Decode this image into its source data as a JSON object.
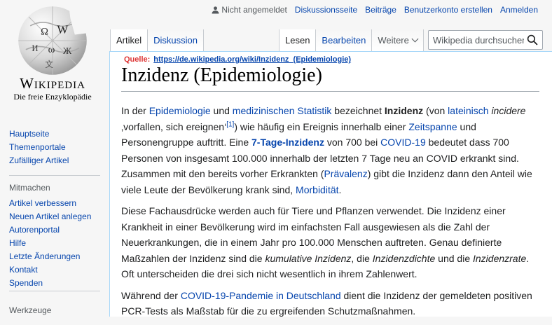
{
  "personal": {
    "user_status": "Nicht angemeldet",
    "links": [
      "Diskussionsseite",
      "Beiträge",
      "Benutzerkonto erstellen",
      "Anmelden"
    ]
  },
  "logo": {
    "wordmark": "Wikipedia",
    "tagline": "Die freie Enzyklopädie"
  },
  "sidebar": {
    "nav": [
      "Hauptseite",
      "Themenportale",
      "Zufälliger Artikel"
    ],
    "mitmachen_heading": "Mitmachen",
    "mitmachen": [
      "Artikel verbessern",
      "Neuen Artikel anlegen",
      "Autorenportal",
      "Hilfe",
      "Letzte Änderungen",
      "Kontakt",
      "Spenden"
    ],
    "werkzeuge_heading": "Werkzeuge"
  },
  "tabs": {
    "left": [
      "Artikel",
      "Diskussion"
    ],
    "right": [
      "Lesen",
      "Bearbeiten",
      "Weitere"
    ]
  },
  "search": {
    "placeholder": "Wikipedia durchsuchen"
  },
  "article": {
    "source_label": "Quelle:",
    "source_url": "https://de.wikipedia.org/wiki/Inzidenz_(Epidemiologie)",
    "title": "Inzidenz (Epidemiologie)",
    "p1": {
      "t1": "In der ",
      "l1": "Epidemiologie",
      "t2": " und ",
      "l2": "medizinischen Statistik",
      "t3": " bezeichnet ",
      "b1": "Inzidenz",
      "t4": " (von ",
      "l3": "lateinisch",
      "t5": " ",
      "i1": "incidere",
      "t6": " ‚vorfallen, sich ereignen‘",
      "ref": "[1]",
      "t7": ") wie häufig ein Ereignis innerhalb einer ",
      "l4": "Zeitspanne",
      "t8": " und Personengruppe auftritt. Eine ",
      "l5": "7-Tage-Inzidenz",
      "t9": " von 700 bei ",
      "l6": "COVID-19",
      "t10": " bedeutet dass 700 Personen von insgesamt 100.000 innerhalb der letzten 7 Tage neu an COVID erkrankt sind. Zusammen mit den bereits vorher Erkrankten (",
      "l7": "Prävalenz",
      "t11": ") gibt die Inzidenz dann den Anteil wie viele Leute der Bevölkerung krank sind, ",
      "l8": "Morbidität",
      "t12": "."
    },
    "p2": {
      "t1": "Diese Fachausdrücke werden auch für Tiere und Pflanzen verwendet. Die Inzidenz einer Krankheit in einer Bevölkerung wird im einfachsten Fall ausgewiesen als die Zahl der Neuerkrankungen, die in einem Jahr pro 100.000 Menschen auftreten. Genau definierte Maßzahlen der Inzidenz sind die ",
      "i1": "kumulative Inzidenz",
      "t2": ", die ",
      "i2": "Inzidenzdichte",
      "t3": " und die ",
      "i3": "Inzidenzrate",
      "t4": ". Oft unterscheiden die drei sich nicht wesentlich in ihrem Zahlenwert."
    },
    "p3": {
      "t1": "Während der ",
      "l1": "COVID-19-Pandemie in Deutschland",
      "t2": " dient die Inzidenz der gemeldeten positiven PCR-Tests als Maßstab für die zu ergreifenden Schutzmaßnahmen."
    }
  },
  "colors": {
    "link": "#0645ad",
    "source_label": "#d33",
    "border": "#a7d7f9"
  }
}
